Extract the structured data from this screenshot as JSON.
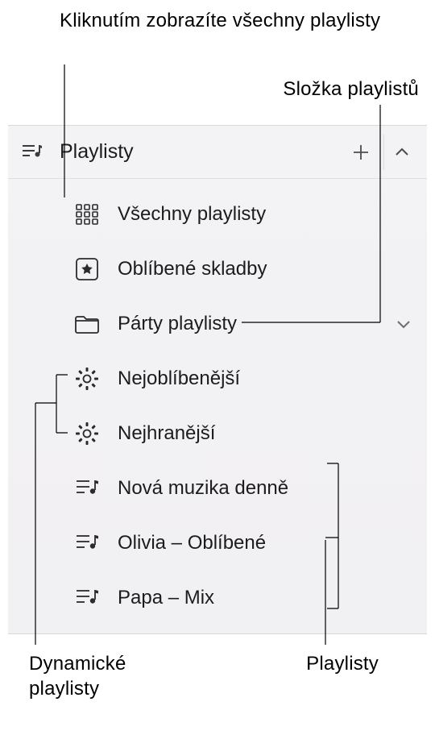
{
  "callouts": {
    "top_left": "Kliknutím zobrazíte všechny playlisty",
    "top_right": "Složka playlistů",
    "bottom_left_line1": "Dynamické",
    "bottom_left_line2": "playlisty",
    "bottom_right": "Playlisty"
  },
  "header": {
    "title": "Playlisty"
  },
  "items": {
    "all": "Všechny playlisty",
    "liked": "Oblíbené skladby",
    "folder": "Párty playlisty",
    "smart1": "Nejoblíbenější",
    "smart2": "Nejhranější",
    "pl1": "Nová muzika denně",
    "pl2": "Olivia – Oblíbené",
    "pl3": "Papa – Mix"
  }
}
